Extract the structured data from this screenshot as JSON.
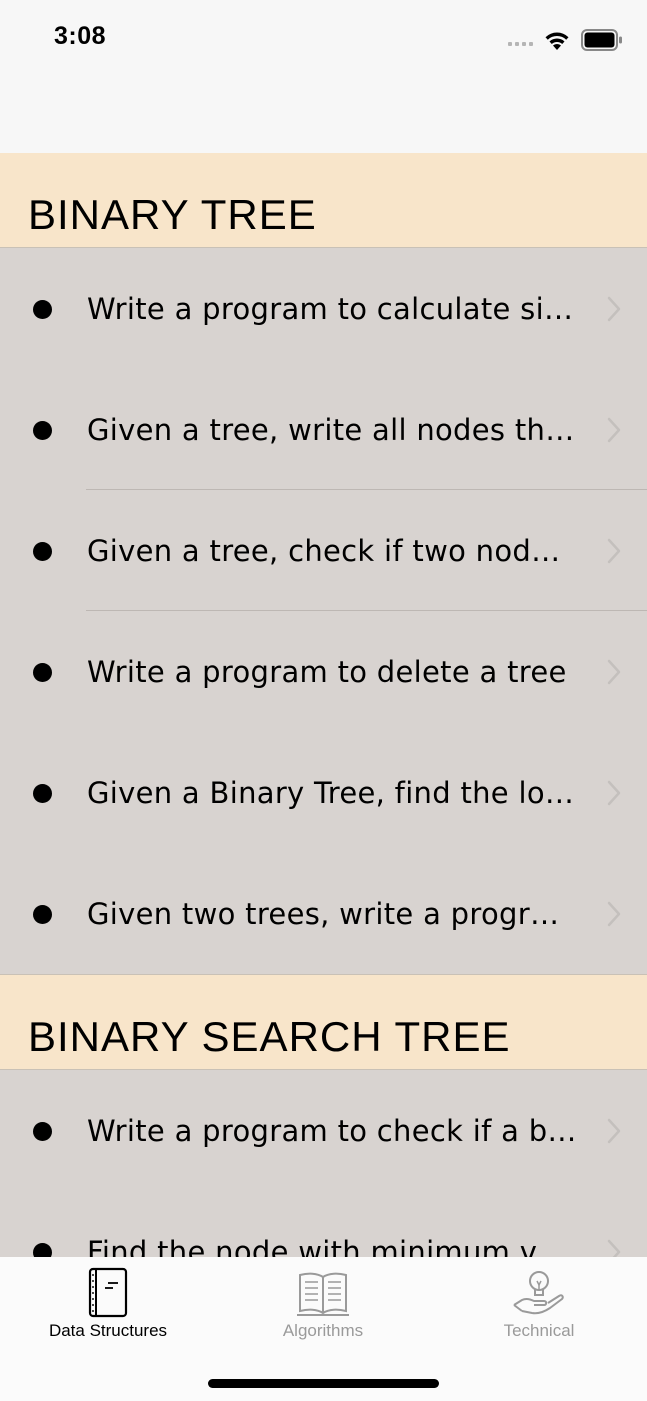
{
  "status_bar": {
    "time": "3:08"
  },
  "sections": [
    {
      "title": "BINARY TREE",
      "items": [
        {
          "label": "Write a program to calculate size of a tree"
        },
        {
          "label": "Given a tree, write all nodes that are at distance k"
        },
        {
          "label": "Given a tree, check if two nodes are cousins"
        },
        {
          "label": "Write a program to delete a tree"
        },
        {
          "label": "Given a Binary Tree, find the lowest common ancestor"
        },
        {
          "label": "Given two trees, write a program to check if identical"
        }
      ]
    },
    {
      "title": "BINARY SEARCH TREE",
      "items": [
        {
          "label": "Write a program to check if a binary tree is BST"
        },
        {
          "label": "Find the node with minimum value in a BST"
        }
      ]
    }
  ],
  "tab_bar": {
    "tabs": [
      {
        "label": "Data Structures",
        "icon": "notebook-icon",
        "active": true
      },
      {
        "label": "Algorithms",
        "icon": "open-book-icon",
        "active": false
      },
      {
        "label": "Technical",
        "icon": "lightbulb-hand-icon",
        "active": false
      }
    ]
  },
  "colors": {
    "section_header_bg": "#f8e5ca",
    "row_bg": "#d8d3d0",
    "active_tab": "#000000",
    "inactive_tab": "#9a9a9a"
  }
}
